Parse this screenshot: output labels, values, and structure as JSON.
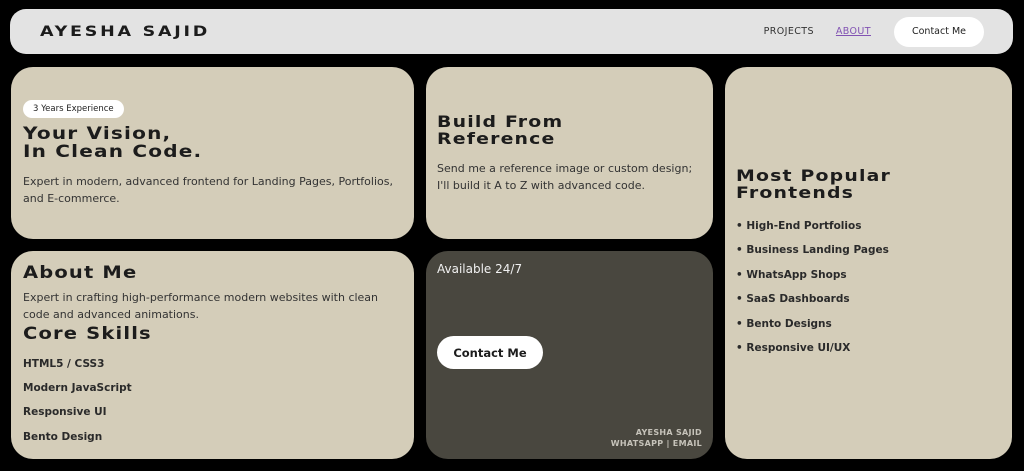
{
  "header": {
    "brand": "AYESHA SAJID",
    "nav": {
      "projects": "PROJECTS",
      "about": "ABOUT"
    },
    "contact_label": "Contact Me"
  },
  "vision_card": {
    "badge": "3 Years Experience",
    "title_line1": "Your Vision,",
    "title_line2": "In Clean Code.",
    "description": "Expert in modern, advanced frontend for Landing Pages, Portfolios, and E-commerce."
  },
  "reference_card": {
    "title": "Build From Reference",
    "description": "Send me a reference image or custom design; I'll build it A to Z with advanced code."
  },
  "popular_card": {
    "title": "Most Popular Frontends",
    "items": [
      "• High-End Portfolios",
      "• Business Landing Pages",
      "• WhatsApp Shops",
      "• SaaS Dashboards",
      "• Bento Designs",
      "• Responsive UI/UX"
    ]
  },
  "about_card": {
    "title": "About Me",
    "description": "Expert in crafting high-performance modern websites with clean code and advanced animations.",
    "skills_title": "Core Skills",
    "skills": [
      "HTML5 / CSS3",
      "Modern JavaScript",
      "Responsive UI",
      "Bento Design"
    ]
  },
  "contact_card": {
    "availability": "Available 24/7",
    "button_label": "Contact Me",
    "signature_name": "AYESHA SAJID",
    "signature_links": "WHATSAPP | EMAIL"
  },
  "colors": {
    "background": "#000000",
    "header_bg": "#e3e3e3",
    "card_bg": "#d4cdb9",
    "dark_card_bg": "#49473f",
    "accent_link": "#8253b3"
  }
}
